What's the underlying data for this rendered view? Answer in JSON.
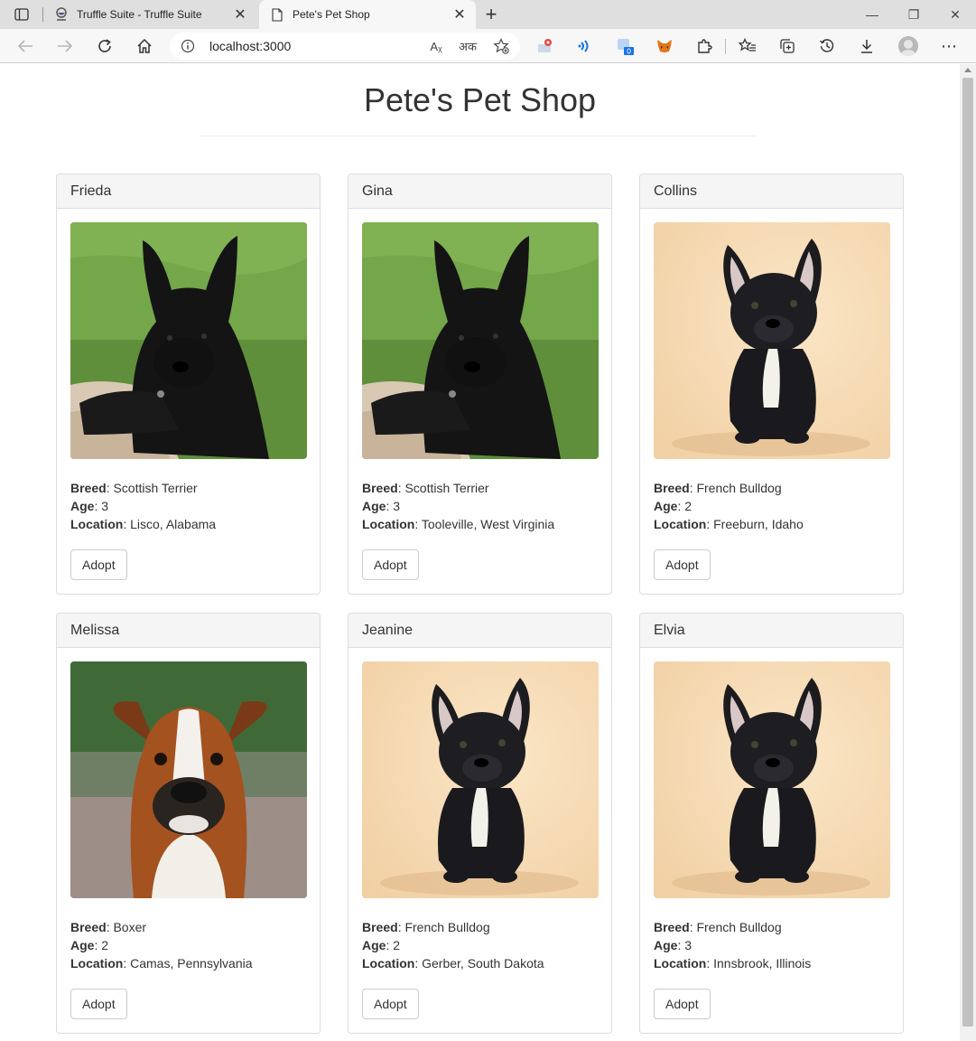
{
  "browser": {
    "tabs": [
      {
        "title": "Truffle Suite - Truffle Suite",
        "active": false
      },
      {
        "title": "Pete's Pet Shop",
        "active": true
      }
    ],
    "url": "localhost:3000",
    "extension_badge": "0",
    "icons": {
      "read_aloud": "Aᵪ",
      "translate": "अक",
      "minimize": "—",
      "restore": "❐",
      "close": "✕",
      "more": "⋯"
    }
  },
  "page": {
    "title": "Pete's Pet Shop",
    "labels": {
      "breed": "Breed",
      "age": "Age",
      "location": "Location"
    },
    "pets": [
      {
        "name": "Frieda",
        "breed": "Scottish Terrier",
        "age": "3",
        "location": "Lisco, Alabama",
        "image": "scottish-terrier",
        "adopt_label": "Adopt"
      },
      {
        "name": "Gina",
        "breed": "Scottish Terrier",
        "age": "3",
        "location": "Tooleville, West Virginia",
        "image": "scottish-terrier",
        "adopt_label": "Adopt"
      },
      {
        "name": "Collins",
        "breed": "French Bulldog",
        "age": "2",
        "location": "Freeburn, Idaho",
        "image": "french-bulldog",
        "adopt_label": "Adopt"
      },
      {
        "name": "Melissa",
        "breed": "Boxer",
        "age": "2",
        "location": "Camas, Pennsylvania",
        "image": "boxer",
        "adopt_label": "Adopt"
      },
      {
        "name": "Jeanine",
        "breed": "French Bulldog",
        "age": "2",
        "location": "Gerber, South Dakota",
        "image": "french-bulldog",
        "adopt_label": "Adopt"
      },
      {
        "name": "Elvia",
        "breed": "French Bulldog",
        "age": "3",
        "location": "Innsbrook, Illinois",
        "image": "french-bulldog",
        "adopt_label": "Adopt"
      }
    ]
  },
  "colors": {
    "card_header_bg": "#f5f5f5",
    "border": "#dddddd",
    "text": "#333333"
  }
}
